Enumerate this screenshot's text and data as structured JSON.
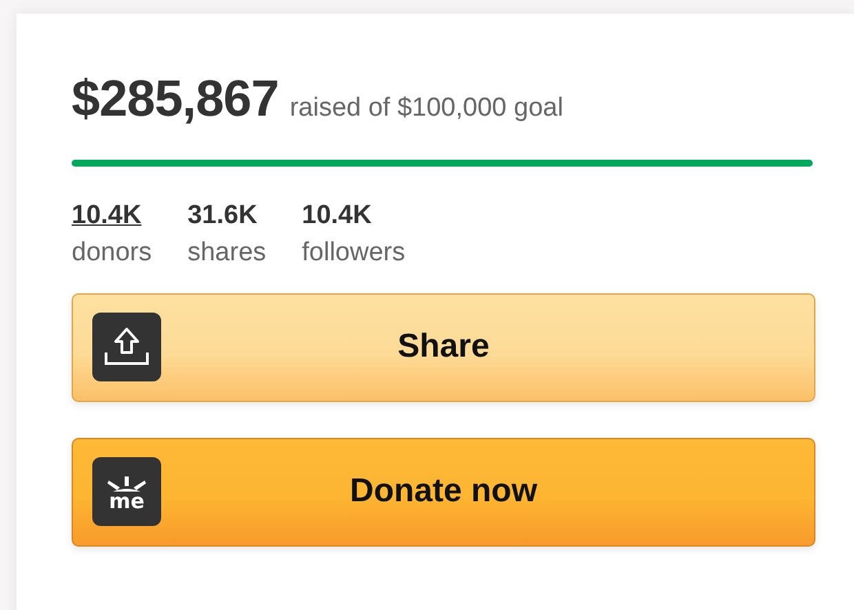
{
  "raised": {
    "amount": "$285,867",
    "caption": "raised of $100,000 goal",
    "level": 1
  },
  "stats": [
    {
      "value": "10.4K",
      "label": "donors",
      "link": true
    },
    {
      "value": "31.6K",
      "label": "shares",
      "link": false
    },
    {
      "value": "10.4K",
      "label": "followers",
      "link": false
    }
  ],
  "buttons": [
    {
      "kind": "share",
      "label": "Share"
    },
    {
      "kind": "donate",
      "label": "Donate now",
      "icon_text": "me"
    }
  ]
}
